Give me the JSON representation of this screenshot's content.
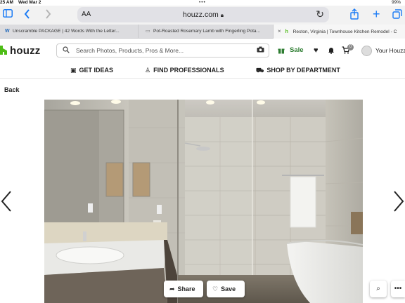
{
  "status": {
    "time": "25 AM",
    "date": "Wed Mar 2",
    "dots": "•••",
    "battery": "99%"
  },
  "toolbar": {
    "text_size_label": "AA",
    "url": "houzz.com"
  },
  "tabs": [
    {
      "favicon": "W",
      "label": "Unscramble PACKAGE | 42 Words With the Letter..."
    },
    {
      "favicon": "▭",
      "label": "Pot-Roasted Rosemary Lamb with Fingerling Pota..."
    },
    {
      "favicon": "h",
      "close": "×",
      "label": "Reston, Virginia | Townhouse Kitchen Remodel - C"
    }
  ],
  "header": {
    "logo": "houzz",
    "search_placeholder": "Search Photos, Products, Pros & More...",
    "sale": "Sale",
    "cart_count": "0",
    "your_houzz": "Your Houzz"
  },
  "nav": {
    "get_ideas": "GET IDEAS",
    "find_professionals": "FIND PROFESSIONALS",
    "shop_by_department": "SHOP BY DEPARTMENT"
  },
  "back": "Back",
  "actions": {
    "share": "Share",
    "save": "Save"
  },
  "colors": {
    "safari_blue": "#1a7bf5",
    "houzz_green": "#4dbc15",
    "sale_green": "#2e7d32"
  }
}
